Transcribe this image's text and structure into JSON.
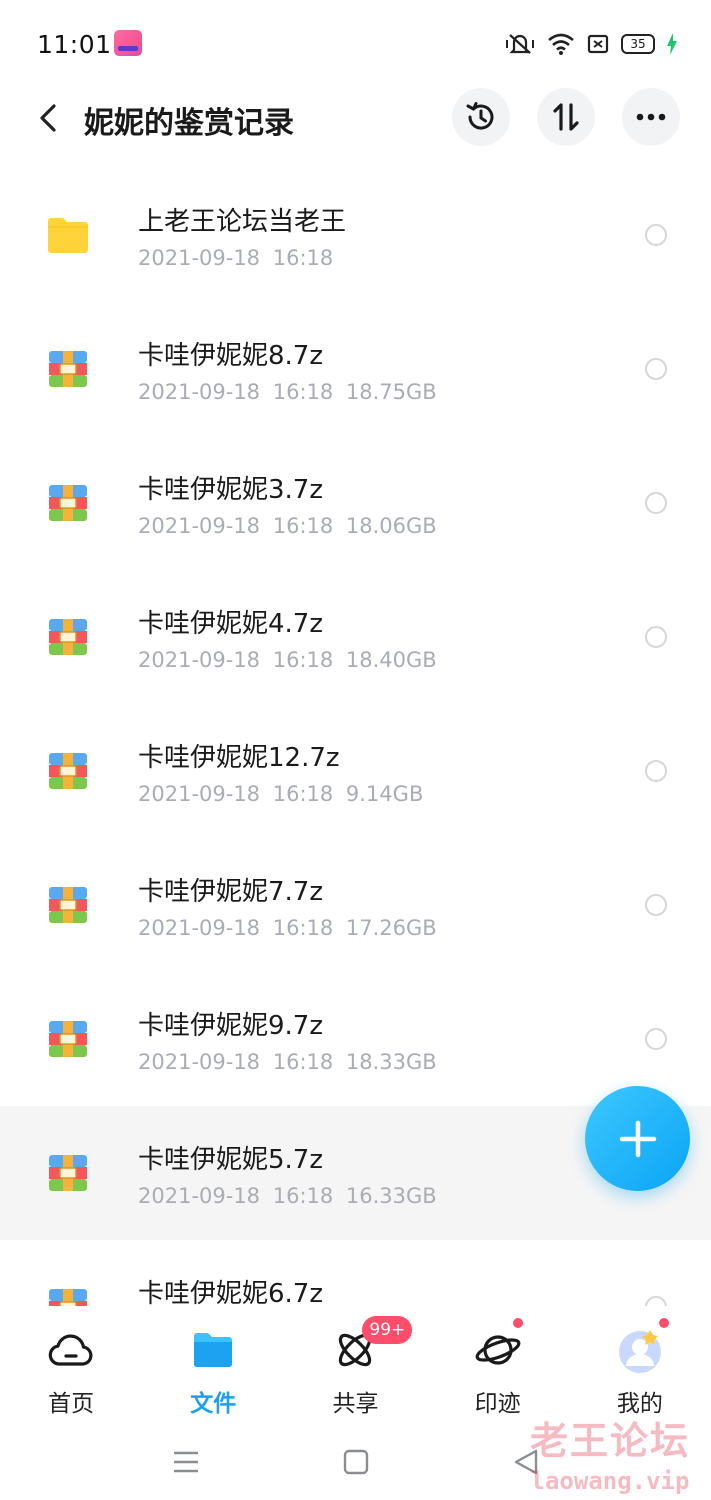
{
  "status_bar": {
    "time": "11:01",
    "battery": "35"
  },
  "header": {
    "title": "妮妮的鉴赏记录"
  },
  "files": [
    {
      "name": "上老王论坛当老王",
      "meta": "2021-09-18 16:18",
      "type": "folder"
    },
    {
      "name": "卡哇伊妮妮8.7z",
      "meta": "2021-09-18 16:18 18.75GB",
      "type": "archive"
    },
    {
      "name": "卡哇伊妮妮3.7z",
      "meta": "2021-09-18 16:18 18.06GB",
      "type": "archive"
    },
    {
      "name": "卡哇伊妮妮4.7z",
      "meta": "2021-09-18 16:18 18.40GB",
      "type": "archive"
    },
    {
      "name": "卡哇伊妮妮12.7z",
      "meta": "2021-09-18 16:18 9.14GB",
      "type": "archive"
    },
    {
      "name": "卡哇伊妮妮7.7z",
      "meta": "2021-09-18 16:18 17.26GB",
      "type": "archive"
    },
    {
      "name": "卡哇伊妮妮9.7z",
      "meta": "2021-09-18 16:18 18.33GB",
      "type": "archive"
    },
    {
      "name": "卡哇伊妮妮5.7z",
      "meta": "2021-09-18 16:18 16.33GB",
      "type": "archive"
    },
    {
      "name": "卡哇伊妮妮6.7z",
      "meta": "",
      "type": "archive"
    }
  ],
  "bottom_nav": {
    "items": [
      {
        "label": "首页",
        "icon": "cloud-icon"
      },
      {
        "label": "文件",
        "icon": "folder-icon",
        "active": true
      },
      {
        "label": "共享",
        "icon": "atom-icon",
        "badge": "99+"
      },
      {
        "label": "印迹",
        "icon": "planet-icon",
        "dot": true
      },
      {
        "label": "我的",
        "icon": "avatar-icon",
        "dot": true
      }
    ]
  },
  "watermark": {
    "cn": "老王论坛",
    "en": "laowang.vip"
  },
  "colors": {
    "accent": "#1b9ff0",
    "folder": "#ffd43b",
    "badge": "#ff4d6b",
    "meta_text": "#a9adb3"
  }
}
